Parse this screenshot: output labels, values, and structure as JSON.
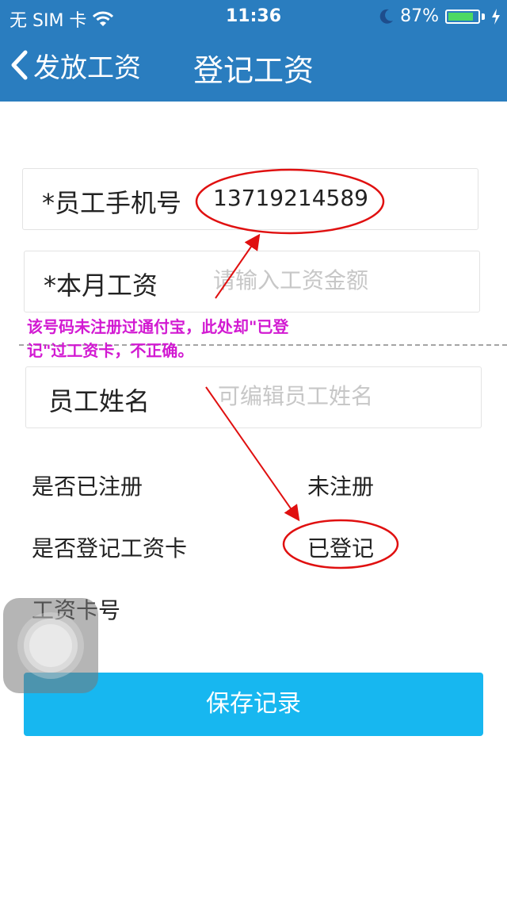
{
  "status_bar": {
    "carrier": "无 SIM 卡",
    "time": "11:36",
    "battery": "87%",
    "battery_level": 0.87,
    "icons": [
      "wifi-icon",
      "moon-icon",
      "battery-icon",
      "charging-icon"
    ]
  },
  "nav": {
    "back_label": "发放工资",
    "title": "登记工资"
  },
  "form": {
    "phone": {
      "label": "*员工手机号",
      "value": "13719214589"
    },
    "salary": {
      "label": "*本月工资",
      "placeholder": "请输入工资金额"
    },
    "name": {
      "label": "员工姓名",
      "placeholder": "可编辑员工姓名"
    }
  },
  "info": {
    "registered_label": "是否已注册",
    "registered_value": "未注册",
    "card_label": "是否登记工资卡",
    "card_value": "已登记",
    "card_no_label": "工资卡号"
  },
  "save_button": "保存记录",
  "annotation": {
    "line1": "该号码未注册过通付宝，此处却\"已登",
    "line2": "记\"过工资卡，不正确。"
  },
  "colors": {
    "header_bg": "#2a7dbf",
    "button_bg": "#17b7f0",
    "annotation_text": "#d21ad2",
    "annotation_marks": "#e01010"
  }
}
